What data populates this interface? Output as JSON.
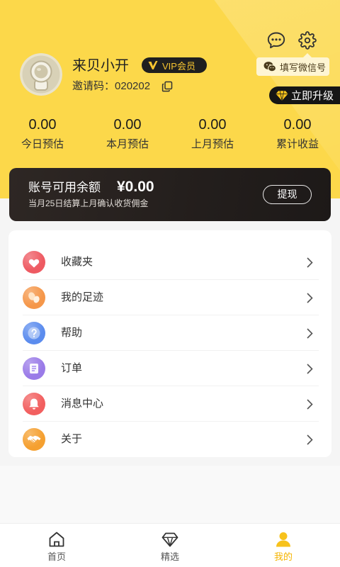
{
  "colors": {
    "header_yellow": "#FCD84A",
    "accent": "#F5B400",
    "card_dark": "#26211F"
  },
  "header": {
    "message_icon": "message-icon",
    "settings_icon": "gear-icon",
    "wechat_icon": "wechat-icon",
    "wechat_tag": "填写微信号",
    "user": {
      "avatar_icon": "avatar-icon",
      "name": "来贝小开",
      "vip_icon": "vip-logo-icon",
      "vip_label": "VIP会员",
      "invite_label": "邀请码：",
      "invite_code": "020202",
      "copy_icon": "copy-icon"
    },
    "upgrade": {
      "icon": "diamond-icon",
      "label": "立即升级"
    },
    "stats": [
      {
        "value": "0.00",
        "label": "今日预估"
      },
      {
        "value": "0.00",
        "label": "本月预估"
      },
      {
        "value": "0.00",
        "label": "上月预估"
      },
      {
        "value": "0.00",
        "label": "累计收益"
      }
    ]
  },
  "balance": {
    "title": "账号可用余额",
    "amount": "¥0.00",
    "note": "当月25日结算上月确认收货佣金",
    "withdraw_label": "提现"
  },
  "menu": [
    {
      "label": "收藏夹",
      "icon": "heart-icon",
      "color": "#EE5A62"
    },
    {
      "label": "我的足迹",
      "icon": "footprint-icon",
      "color": "#F5974A"
    },
    {
      "label": "帮助",
      "icon": "help-icon",
      "color": "#5B8CEE"
    },
    {
      "label": "订单",
      "icon": "order-icon",
      "color": "#9A7BE8"
    },
    {
      "label": "消息中心",
      "icon": "bell-icon",
      "color": "#F25F5F"
    },
    {
      "label": "关于",
      "icon": "handshake-icon",
      "color": "#F5A030"
    }
  ],
  "tabbar": [
    {
      "label": "首页",
      "icon": "home-icon",
      "active": false
    },
    {
      "label": "精选",
      "icon": "diamond-outline-icon",
      "active": false
    },
    {
      "label": "我的",
      "icon": "person-icon",
      "active": true
    }
  ]
}
